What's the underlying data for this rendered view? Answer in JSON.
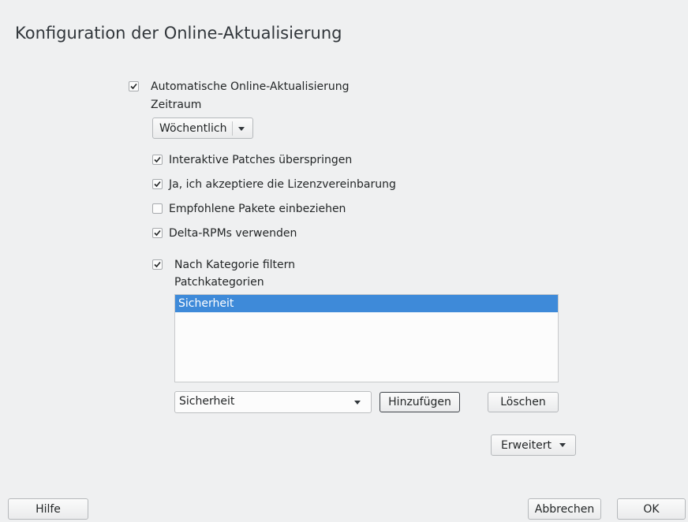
{
  "window": {
    "title": "Konfiguration der Online-Aktualisierung"
  },
  "auto_update": {
    "label": "Automatische Online-Aktualisierung",
    "checked": true
  },
  "period": {
    "label": "Zeitraum",
    "selected": "Wöchentlich"
  },
  "options": [
    {
      "label": "Interaktive Patches überspringen",
      "checked": true
    },
    {
      "label": "Ja, ich akzeptiere die Lizenzvereinbarung",
      "checked": true
    },
    {
      "label": "Empfohlene Pakete einbeziehen",
      "checked": false
    },
    {
      "label": "Delta-RPMs verwenden",
      "checked": true
    }
  ],
  "category_filter": {
    "label": "Nach Kategorie filtern",
    "checked": true
  },
  "patch_categories": {
    "label": "Patchkategorien",
    "items": [
      "Sicherheit"
    ],
    "combo_value": "Sicherheit",
    "add_label": "Hinzufügen",
    "delete_label": "Löschen"
  },
  "advanced_label": "Erweitert",
  "footer": {
    "help": "Hilfe",
    "cancel": "Abbrechen",
    "ok": "OK"
  },
  "colors": {
    "selection": "#3e8ad9",
    "background": "#eff0f1"
  }
}
